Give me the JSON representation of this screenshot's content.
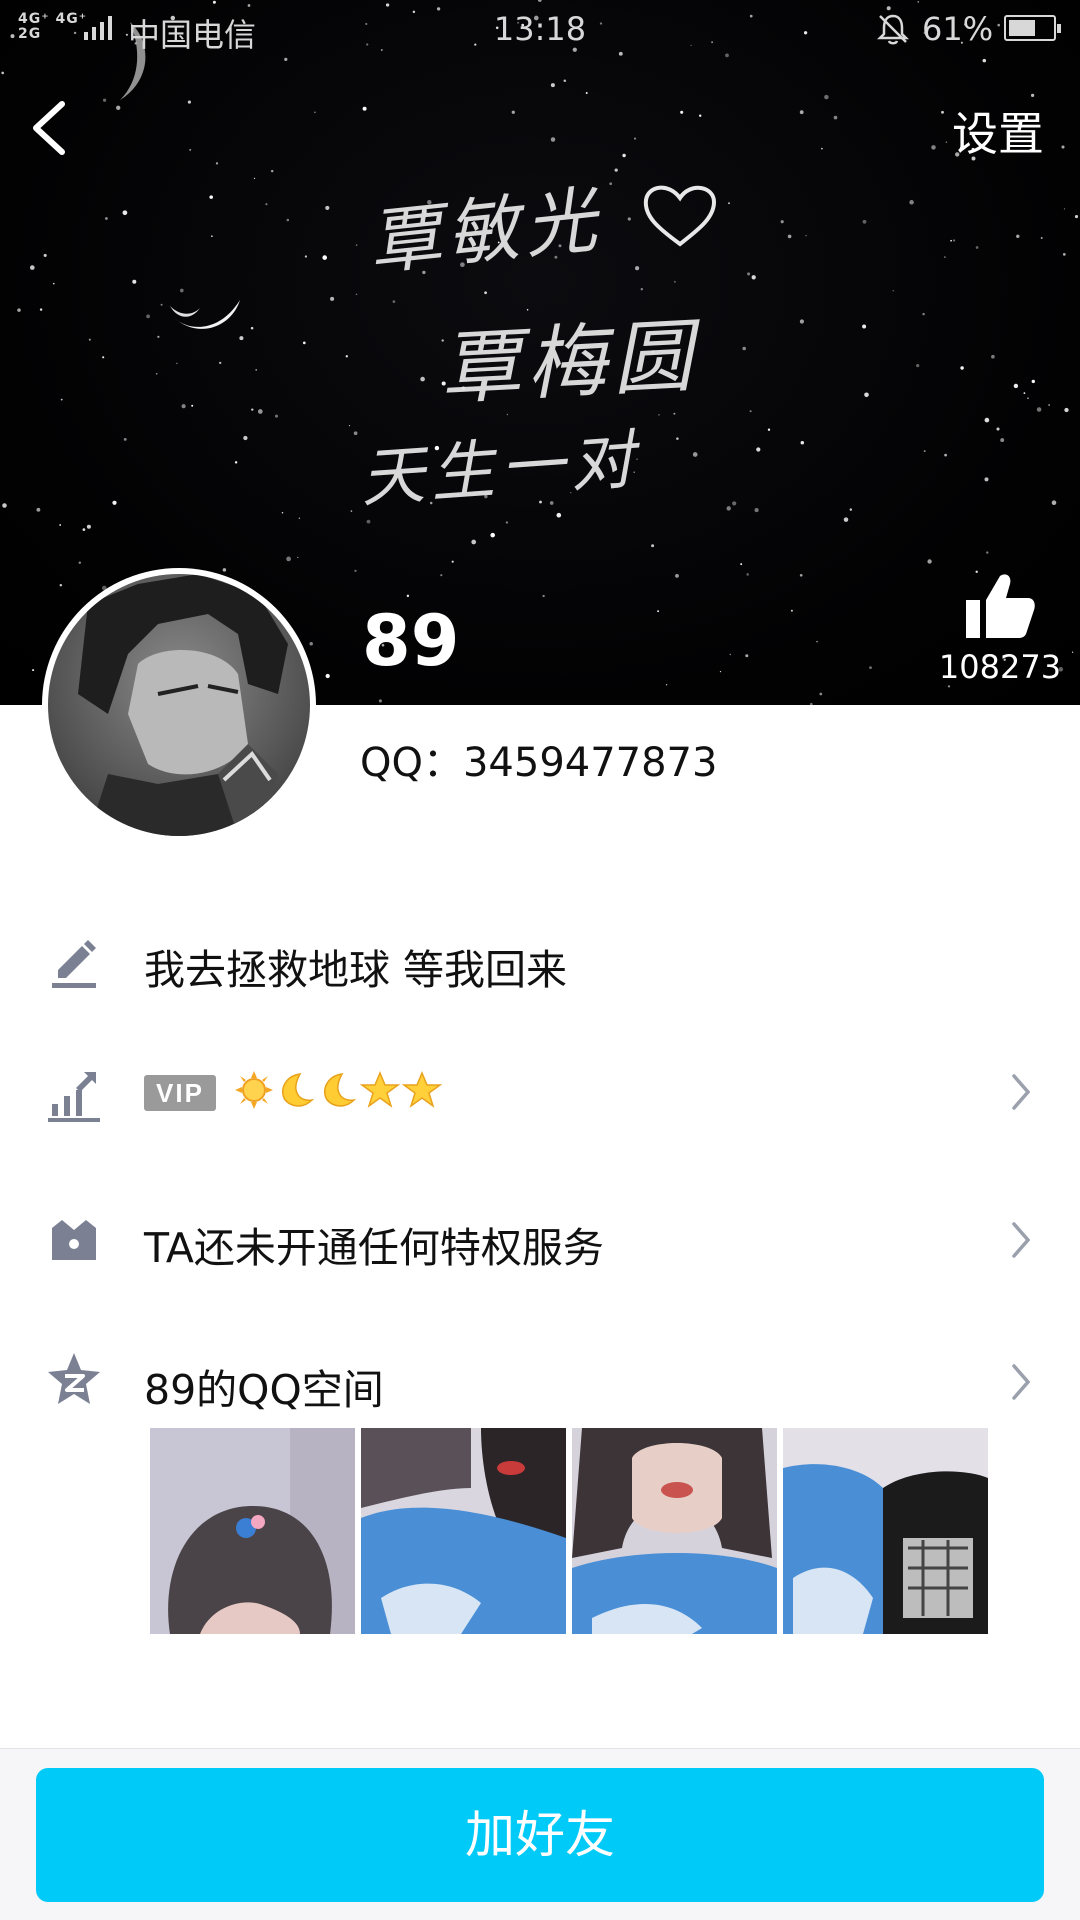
{
  "status_bar": {
    "network": "4G⁺ 4G⁺\n2G",
    "carrier": "中国电信",
    "time": "13:18",
    "battery_percent": "61%",
    "battery_level": 0.61
  },
  "header": {
    "settings_label": "设置",
    "cover_text": [
      "覃敏光",
      "覃梅圆",
      "天生一对"
    ],
    "nickname": "89",
    "like_count": "108273"
  },
  "profile": {
    "qq_number": "QQ：3459477873"
  },
  "rows": {
    "signature": "我去拯救地球 等我回来",
    "vip_badge": "VIP",
    "level_icons": [
      "sun-icon",
      "moon-icon",
      "moon-icon",
      "star-icon",
      "star-icon"
    ],
    "privilege": "TA还未开通任何特权服务",
    "qzone": "89的QQ空间"
  },
  "footer": {
    "add_friend_label": "加好友"
  },
  "colors": {
    "accent": "#00caf7",
    "icon_gray": "#7b8193",
    "header_bg": "#000000"
  }
}
